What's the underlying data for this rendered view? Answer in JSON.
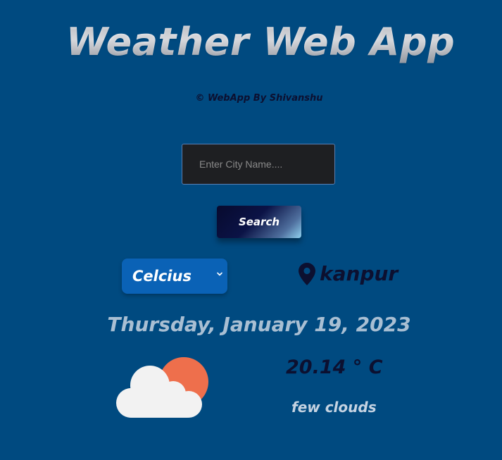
{
  "app": {
    "title": "Weather Web App",
    "credit": "© WebApp By Shivanshu"
  },
  "search": {
    "placeholder": "Enter City Name....",
    "value": "",
    "button_label": "Search"
  },
  "units": {
    "selected": "Celcius"
  },
  "location": {
    "icon": "location-pin-icon",
    "city": "kanpur"
  },
  "weather": {
    "date": "Thursday, January 19, 2023",
    "temperature": "20.14 ° C",
    "description": "few clouds",
    "icon": "cloud-sun-icon"
  },
  "colors": {
    "background": "#004a80",
    "sun": "#ee6f4c",
    "cloud": "#f2f2f2",
    "dark_text": "#0c1030",
    "select_bg": "#0a62b6"
  }
}
